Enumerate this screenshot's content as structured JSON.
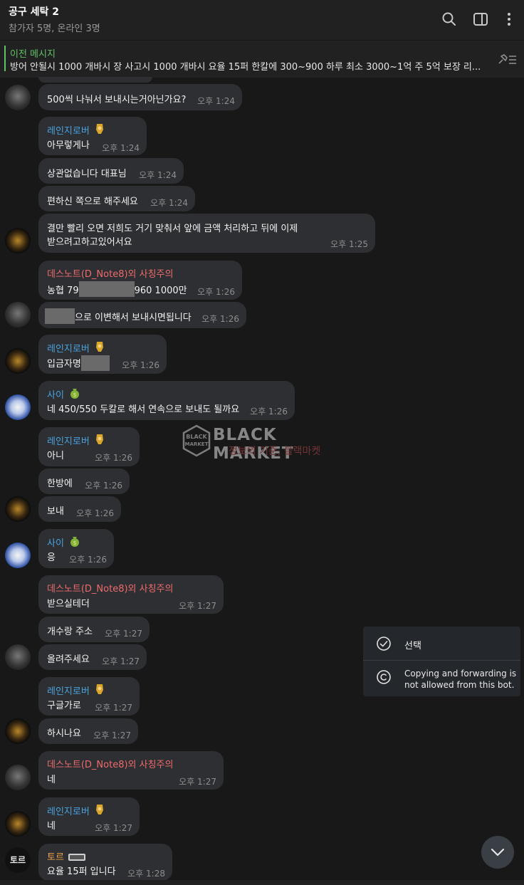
{
  "header": {
    "title": "공구 세탁 2",
    "subtitle": "참가자 5명, 온라인 3명"
  },
  "pinned": {
    "label": "이전 메시지",
    "text": "방어 안될시 1000 개바시 장 사고시 1000 개바시  요율 15퍼  한칼에 300~900 하루 최소 3000~1억 주 5억 보장 리..."
  },
  "watermark": {
    "title": "BLACK MARKET",
    "subtitle": "정보의 기준, 블랙마켓"
  },
  "messages": [
    {
      "sender": "",
      "text": "500씩 나눠서 보내시는거아닌가요?",
      "time": "오후 1:24"
    },
    {
      "sender": "레인지로버",
      "text": "아무렇게나",
      "time": "오후 1:24"
    },
    {
      "sender": "",
      "text": "상관없습니다 대표님",
      "time": "오후 1:24"
    },
    {
      "sender": "",
      "text": "편하신 쪽으로 해주세요",
      "time": "오후 1:24"
    },
    {
      "sender": "",
      "text_line1": "결만 빨리 오면 저희도 거기 맞춰서 앞에 금액 처리하고 뒤에 이제",
      "text_line2": "받으려고하고있어서요",
      "time": "오후 1:25"
    },
    {
      "sender": "데스노트(D_Note8)",
      "sender_suffix": "외 사칭주의",
      "text_a": "농협 79",
      "text_b": "960 1000만",
      "time": "오후 1:26"
    },
    {
      "sender": "",
      "text": "으로 이변해서 보내시면됩니다",
      "time": "오후 1:26"
    },
    {
      "sender": "레인지로버",
      "text": "입금자명",
      "time": "오후 1:26"
    },
    {
      "sender": "사이",
      "text": "네 450/550 두칼로 해서 연속으로 보내도 될까요",
      "time": "오후 1:26"
    },
    {
      "sender": "레인지로버",
      "text": "아니",
      "time": "오후 1:26"
    },
    {
      "sender": "",
      "text": "한방에",
      "time": "오후 1:26"
    },
    {
      "sender": "",
      "text": "보내",
      "time": "오후 1:26"
    },
    {
      "sender": "사이",
      "text": "응",
      "time": "오후 1:26"
    },
    {
      "sender": "데스노트(D_Note8)",
      "sender_suffix": "외 사칭주의",
      "text": "받으실테더",
      "time": "오후 1:27"
    },
    {
      "sender": "",
      "text": "개수랑 주소",
      "time": "오후 1:27"
    },
    {
      "sender": "",
      "text": "올려주세요",
      "time": "오후 1:27"
    },
    {
      "sender": "레인지로버",
      "text": "구글가로",
      "time": "오후 1:27"
    },
    {
      "sender": "",
      "text": "하시나요",
      "time": "오후 1:27"
    },
    {
      "sender": "데스노트(D_Note8)",
      "sender_suffix": "외 사칭주의",
      "text": "네",
      "time": "오후 1:27"
    },
    {
      "sender": "레인지로버",
      "text": "네",
      "time": "오후 1:27"
    },
    {
      "sender": "토르",
      "text": "요율 15퍼 입니다",
      "time": "오후 1:28"
    }
  ],
  "avatar_labels": {
    "tor": "토르"
  },
  "context_menu": {
    "select_label": "선택",
    "copy_notice": "Copying and forwarding is not allowed from this bot."
  },
  "icons": [
    "search-icon",
    "sidebar-toggle-icon",
    "more-vertical-icon",
    "pin-list-icon",
    "check-circle-icon",
    "copyright-icon",
    "chevron-down-icon"
  ],
  "colors": {
    "background": "#181818",
    "bubble": "#2d2f33",
    "sender_blue": "#4aa3df",
    "sender_red": "#ef6b6b",
    "pinned_green": "#5fc366"
  }
}
